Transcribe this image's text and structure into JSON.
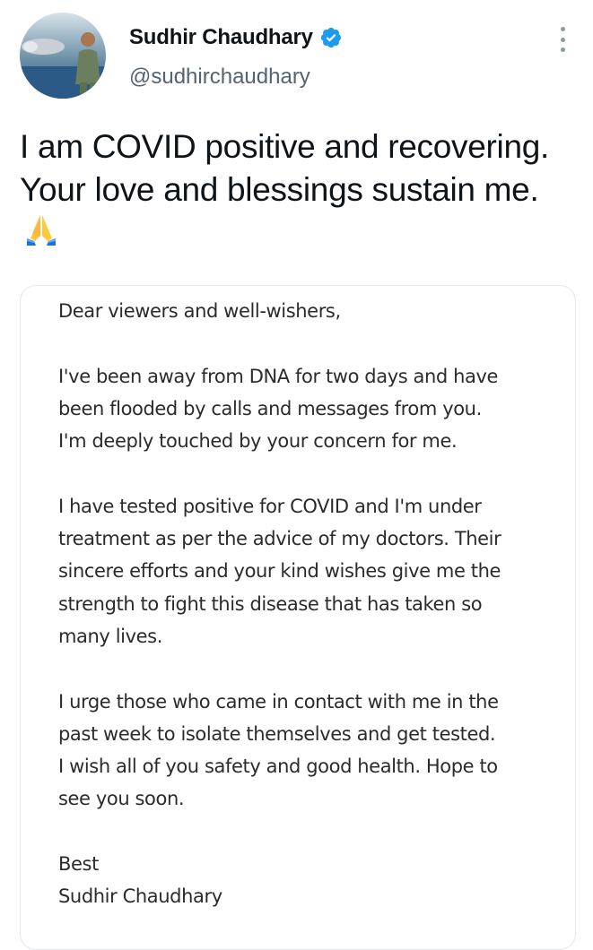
{
  "author": {
    "display_name": "Sudhir Chaudhary",
    "handle": "@sudhirchaudhary",
    "verified": true,
    "verified_color": "#1d9bf0"
  },
  "tweet": {
    "text": "I am COVID positive and recovering. Your love and blessings sustain me.",
    "emoji_icon": "folded-hands-icon"
  },
  "letter": {
    "greeting": "Dear viewers and well-wishers,",
    "paragraph_1": [
      "I've been away from DNA for two days and have",
      "been flooded by calls and messages from you.",
      "I'm deeply touched by your concern for me."
    ],
    "paragraph_2": [
      "I have tested positive for COVID and I'm under",
      "treatment as per the advice of my doctors. Their",
      "sincere efforts and your kind wishes give me the",
      "strength to fight this disease that has taken so",
      "many lives."
    ],
    "paragraph_3": [
      "I urge those who came in contact with me in the",
      "past week to isolate themselves and get tested.",
      "I wish all of you safety and good health. Hope to",
      "see you soon."
    ],
    "closing": "Best",
    "signature": "Sudhir Chaudhary"
  }
}
